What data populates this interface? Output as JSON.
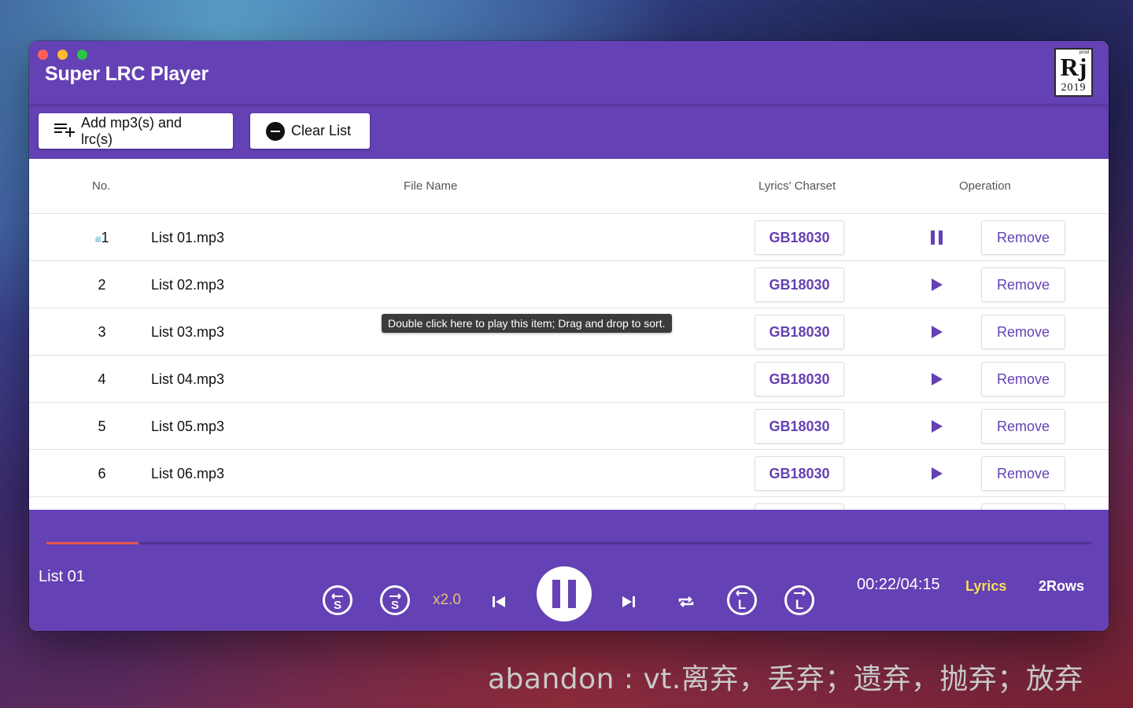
{
  "window": {
    "title": "Super LRC Player",
    "logo": {
      "small": "prod",
      "main": "Rj",
      "year": "2019"
    }
  },
  "toolbar": {
    "add_label": "Add mp3(s) and lrc(s)",
    "clear_label": "Clear List"
  },
  "table": {
    "headers": {
      "no": "No.",
      "file": "File Name",
      "charset": "Lyrics' Charset",
      "operation": "Operation"
    },
    "rows": [
      {
        "no": "1",
        "file": "List 01.mp3",
        "charset": "GB18030",
        "remove": "Remove",
        "state": "playing"
      },
      {
        "no": "2",
        "file": "List 02.mp3",
        "charset": "GB18030",
        "remove": "Remove",
        "state": "stopped"
      },
      {
        "no": "3",
        "file": "List 03.mp3",
        "charset": "GB18030",
        "remove": "Remove",
        "state": "stopped"
      },
      {
        "no": "4",
        "file": "List 04.mp3",
        "charset": "GB18030",
        "remove": "Remove",
        "state": "stopped"
      },
      {
        "no": "5",
        "file": "List 05.mp3",
        "charset": "GB18030",
        "remove": "Remove",
        "state": "stopped"
      },
      {
        "no": "6",
        "file": "List 06.mp3",
        "charset": "GB18030",
        "remove": "Remove",
        "state": "stopped"
      }
    ],
    "tooltip": "Double click here to play this item; Drag and drop to sort."
  },
  "player": {
    "now_playing": "List 01",
    "progress_fraction": 0.088,
    "speed": "x2.0",
    "time": "00:22/04:15",
    "lyrics_label": "Lyrics",
    "rows_label": "2Rows",
    "subtitle_letter": "S",
    "lyric_letter": "L"
  },
  "lyric_overlay": "abandon : vt.离弃，丢弃；遗弃，抛弃；放弃",
  "colors": {
    "brand": "#6441b4",
    "progress": "#e0574a",
    "lyrics_active": "#f7dd5a",
    "speed": "#e6c07a"
  }
}
